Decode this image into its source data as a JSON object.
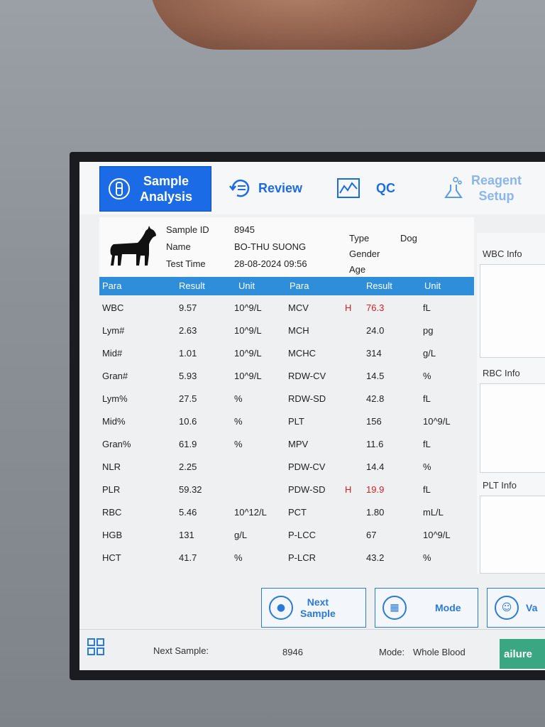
{
  "nav": {
    "sample_analysis_line1": "Sample",
    "sample_analysis_line2": "Analysis",
    "review": "Review",
    "qc": "QC",
    "reagent_line1": "Reagent",
    "reagent_line2": "Setup"
  },
  "sample": {
    "sample_id_label": "Sample ID",
    "sample_id": "8945",
    "name_label": "Name",
    "name": "BO-THU SUONG",
    "test_time_label": "Test Time",
    "test_time": "28-08-2024 09:56",
    "type_label": "Type",
    "type": "Dog",
    "gender_label": "Gender",
    "gender": "",
    "age_label": "Age",
    "age": ""
  },
  "table": {
    "headers": [
      "Para",
      "Result",
      "Unit",
      "Para",
      "Result",
      "Unit"
    ],
    "left": [
      {
        "para": "WBC",
        "result": "9.57",
        "unit": "10^9/L"
      },
      {
        "para": "Lym#",
        "result": "2.63",
        "unit": "10^9/L"
      },
      {
        "para": "Mid#",
        "result": "1.01",
        "unit": "10^9/L"
      },
      {
        "para": "Gran#",
        "result": "5.93",
        "unit": "10^9/L"
      },
      {
        "para": "Lym%",
        "result": "27.5",
        "unit": "%"
      },
      {
        "para": "Mid%",
        "result": "10.6",
        "unit": "%"
      },
      {
        "para": "Gran%",
        "result": "61.9",
        "unit": "%"
      },
      {
        "para": "NLR",
        "result": "2.25",
        "unit": ""
      },
      {
        "para": "PLR",
        "result": "59.32",
        "unit": ""
      },
      {
        "para": "RBC",
        "result": "5.46",
        "unit": "10^12/L"
      },
      {
        "para": "HGB",
        "result": "131",
        "unit": "g/L"
      },
      {
        "para": "HCT",
        "result": "41.7",
        "unit": "%"
      }
    ],
    "right": [
      {
        "para": "MCV",
        "flag": "H",
        "result": "76.3",
        "unit": "fL"
      },
      {
        "para": "MCH",
        "flag": "",
        "result": "24.0",
        "unit": "pg"
      },
      {
        "para": "MCHC",
        "flag": "",
        "result": "314",
        "unit": "g/L"
      },
      {
        "para": "RDW-CV",
        "flag": "",
        "result": "14.5",
        "unit": "%"
      },
      {
        "para": "RDW-SD",
        "flag": "",
        "result": "42.8",
        "unit": "fL"
      },
      {
        "para": "PLT",
        "flag": "",
        "result": "156",
        "unit": "10^9/L"
      },
      {
        "para": "MPV",
        "flag": "",
        "result": "11.6",
        "unit": "fL"
      },
      {
        "para": "PDW-CV",
        "flag": "",
        "result": "14.4",
        "unit": "%"
      },
      {
        "para": "PDW-SD",
        "flag": "H",
        "result": "19.9",
        "unit": "fL"
      },
      {
        "para": "PCT",
        "flag": "",
        "result": "1.80",
        "unit": "mL/L"
      },
      {
        "para": "P-LCC",
        "flag": "",
        "result": "67",
        "unit": "10^9/L"
      },
      {
        "para": "P-LCR",
        "flag": "",
        "result": "43.2",
        "unit": "%"
      }
    ]
  },
  "panels": {
    "wbc": "WBC Info",
    "rbc": "RBC Info",
    "plt": "PLT Info"
  },
  "buttons": {
    "next_sample_line1": "Next",
    "next_sample_line2": "Sample",
    "mode": "Mode",
    "partial": "Va"
  },
  "status": {
    "next_sample_label": "Next Sample:",
    "next_sample_value": "8946",
    "mode_label": "Mode:",
    "mode_value": "Whole Blood",
    "alert": "ailure"
  },
  "colors": {
    "accent": "#1c6be6",
    "table_header": "#2f8ed9",
    "high_flag": "#d42020",
    "alert_bg": "#3aa682"
  }
}
